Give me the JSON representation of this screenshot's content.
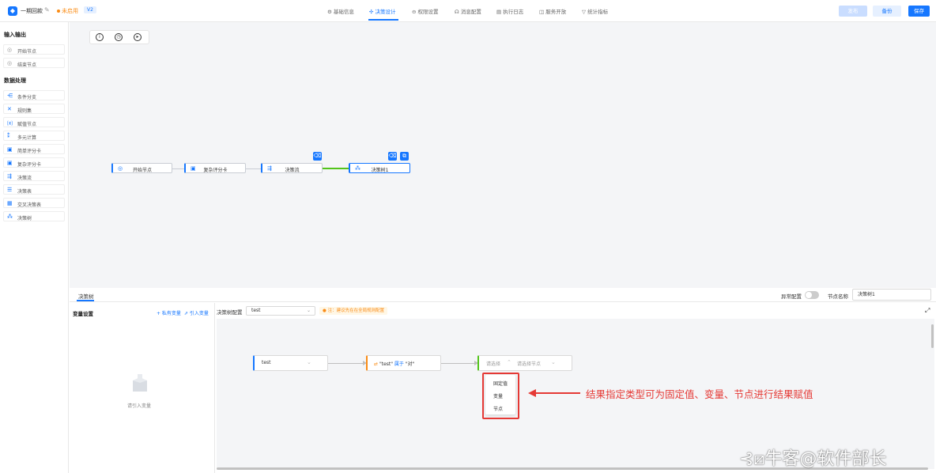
{
  "header": {
    "app_title": "一期回款",
    "status": "未启用",
    "version": "V2",
    "tabs": [
      {
        "icon": "⚙",
        "label": "基础信息"
      },
      {
        "icon": "✣",
        "label": "决策设计"
      },
      {
        "icon": "⊖",
        "label": "权限设置"
      },
      {
        "icon": "☊",
        "label": "消息配置"
      },
      {
        "icon": "▤",
        "label": "执行日志"
      },
      {
        "icon": "◫",
        "label": "服务开放"
      },
      {
        "icon": "▽",
        "label": "统计指标"
      }
    ],
    "buttons": {
      "publish": "发布",
      "backup": "备份",
      "save": "保存"
    }
  },
  "sidebar": {
    "sections": [
      {
        "title": "输入输出",
        "items": [
          {
            "icon": "◎",
            "label": "开始节点"
          },
          {
            "icon": "◎",
            "label": "结束节点"
          }
        ]
      },
      {
        "title": "数据处理",
        "items": [
          {
            "icon": "⋲",
            "label": "条件分支"
          },
          {
            "icon": "✕",
            "label": "规则集"
          },
          {
            "icon": "⒳",
            "label": "赋值节点"
          },
          {
            "icon": "⁑",
            "label": "多元计算"
          },
          {
            "icon": "▣",
            "label": "简单评分卡"
          },
          {
            "icon": "▣",
            "label": "复杂评分卡"
          },
          {
            "icon": "⇶",
            "label": "决策流"
          },
          {
            "icon": "☰",
            "label": "决策表"
          },
          {
            "icon": "▦",
            "label": "交叉决策表"
          },
          {
            "icon": "⁂",
            "label": "决策树"
          }
        ]
      }
    ]
  },
  "canvas": {
    "flow_nodes": [
      {
        "icon": "◎",
        "label": "开始节点"
      },
      {
        "icon": "▣",
        "label": "复杂评分卡"
      },
      {
        "icon": "⇶",
        "label": "决策流"
      },
      {
        "icon": "⁂",
        "label": "决策树1"
      }
    ]
  },
  "bottom": {
    "tab": "决策树",
    "exception_label": "异常配置",
    "node_name_label": "节点名称",
    "node_name_value": "决策树1",
    "var_title": "变量设置",
    "private_var": "+ 私有变量",
    "import_var": "⇗ 引入变量",
    "empty_text": "请引入变量",
    "config_label": "决策树配置",
    "config_select": "test",
    "config_note": "注：建议先在在全局规则配置",
    "tree": {
      "node1": "test",
      "node2_prefix": "\"test\"",
      "node2_op": "属于",
      "node2_suffix": "\"对\"",
      "result_type": "请选择",
      "result_target": "请选择节点"
    },
    "dropdown_options": [
      "固定值",
      "变量",
      "节点"
    ],
    "annotation": "结果指定类型可为固定值、变量、节点进行结果赋值"
  },
  "watermark": "牛客@软件部长",
  "colors": {
    "accent": "#1677ff",
    "annotation": "#e53935",
    "warning": "#fa8c16"
  }
}
